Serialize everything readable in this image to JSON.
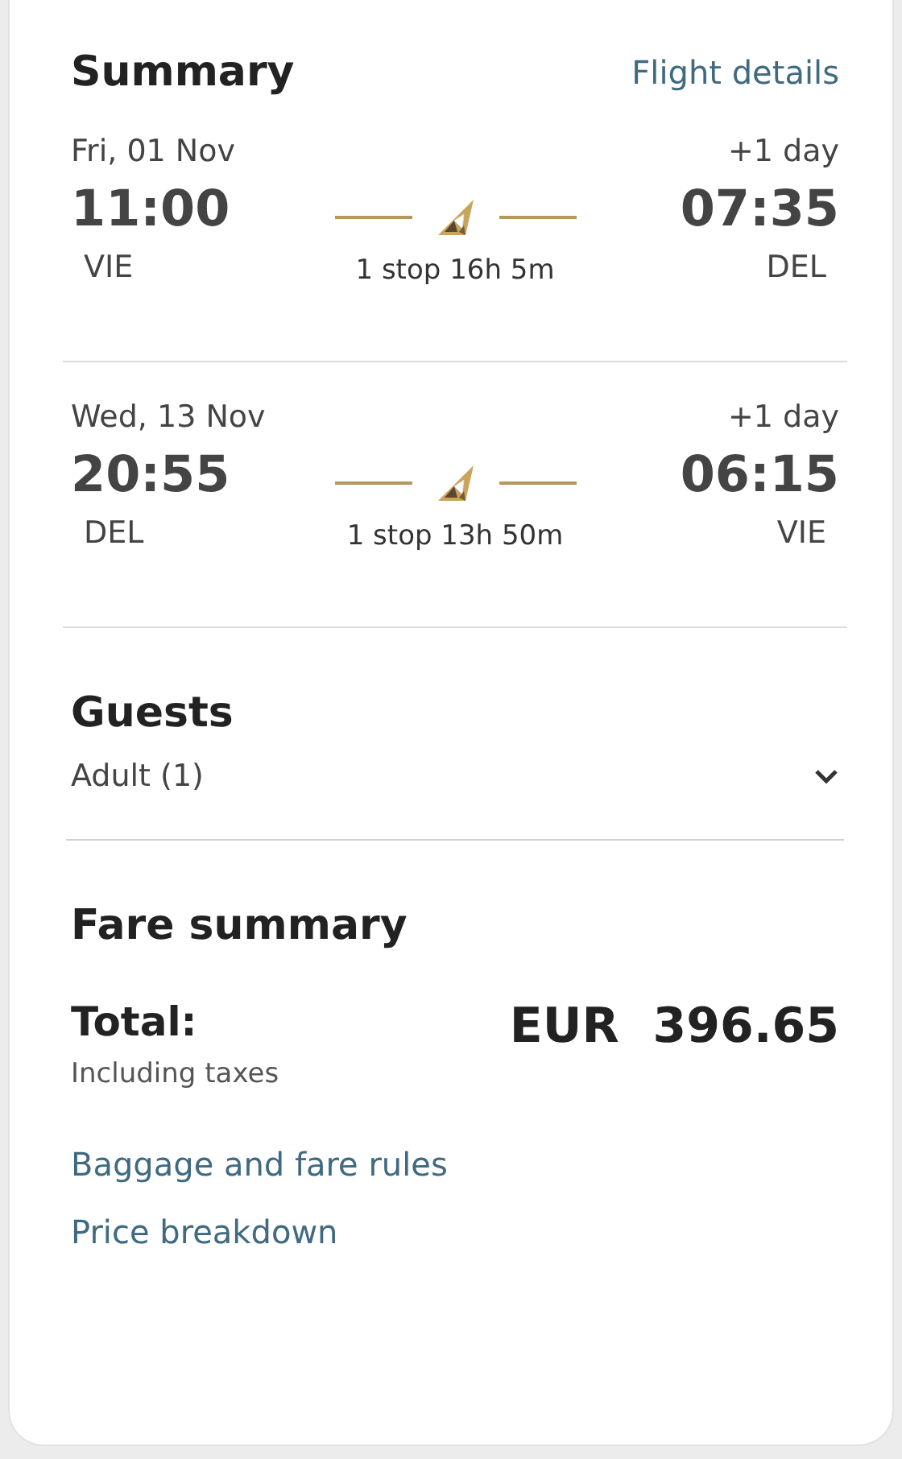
{
  "header": {
    "title": "Summary",
    "link": "Flight details"
  },
  "flights": [
    {
      "date": "Fri, 01 Nov",
      "depart_time": "11:00",
      "depart_code": "VIE",
      "arrive_note": "+1 day",
      "arrive_time": "07:35",
      "arrive_code": "DEL",
      "duration": "1 stop 16h 5m"
    },
    {
      "date": "Wed, 13 Nov",
      "depart_time": "20:55",
      "depart_code": "DEL",
      "arrive_note": "+1 day",
      "arrive_time": "06:15",
      "arrive_code": "VIE",
      "duration": "1 stop 13h 50m"
    }
  ],
  "guests": {
    "title": "Guests",
    "value": "Adult (1)",
    "expanded": false
  },
  "fare": {
    "title": "Fare summary",
    "total_label": "Total:",
    "total_note": "Including taxes",
    "amount": "EUR  396.65",
    "links": [
      "Baggage and fare rules",
      "Price breakdown"
    ]
  }
}
